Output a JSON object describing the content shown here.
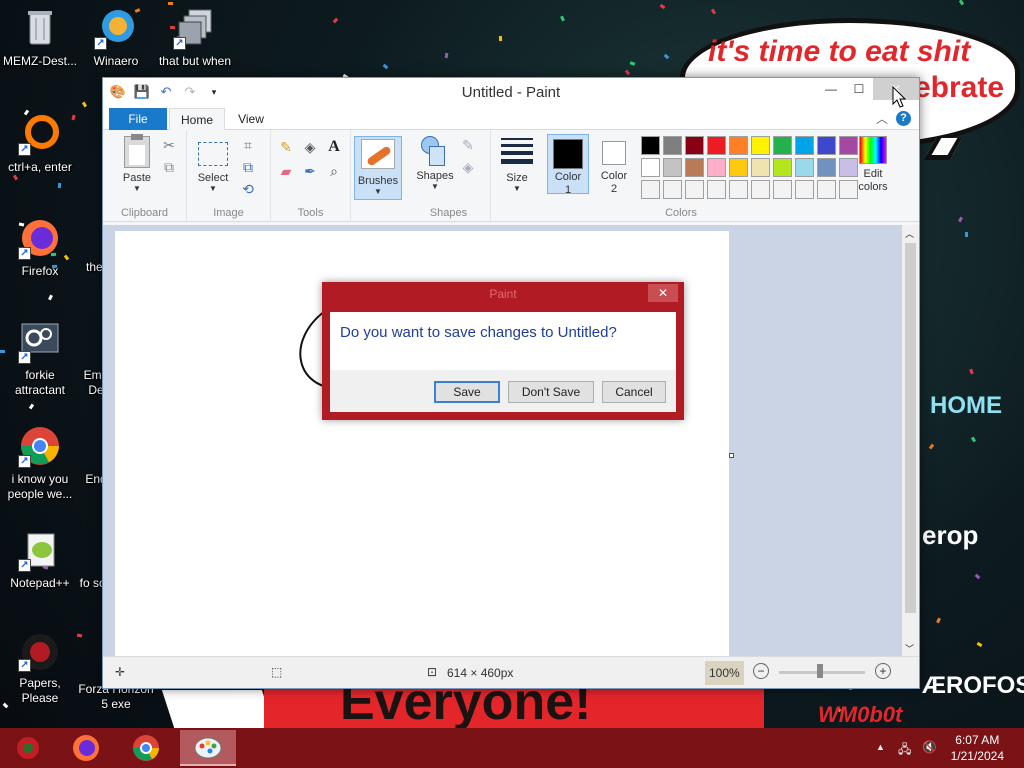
{
  "desktop": {
    "speech_line1": "it's time to eat shit",
    "speech_line2": "ebrate",
    "banner": "Everyone!",
    "bg_home": "HOME",
    "bg_erop": "erop",
    "bg_aero": "ÆROFOS",
    "bg_wmob": "WM0b0t",
    "icons": [
      {
        "label": "MEMZ-Dest..."
      },
      {
        "label": "Winaero"
      },
      {
        "label": "that but when"
      },
      {
        "label": "ctrl+a, enter"
      },
      {
        "label": "Firefox"
      },
      {
        "label": "the"
      },
      {
        "label": "forkie attractant"
      },
      {
        "label": "Emb De"
      },
      {
        "label": "i know you people we..."
      },
      {
        "label": "End"
      },
      {
        "label": "Notepad++"
      },
      {
        "label": "fo son"
      },
      {
        "label": "Papers, Please"
      },
      {
        "label": "Forza Horizon 5 exe"
      }
    ]
  },
  "paint": {
    "title": "Untitled - Paint",
    "tabs": {
      "file": "File",
      "home": "Home",
      "view": "View"
    },
    "groups": {
      "clipboard": {
        "label": "Clipboard",
        "paste": "Paste"
      },
      "image": {
        "label": "Image",
        "select": "Select"
      },
      "tools": {
        "label": "Tools"
      },
      "brushes": {
        "label": "Brushes"
      },
      "shapes": {
        "label": "Shapes",
        "shapes_btn": "Shapes"
      },
      "size": {
        "label": "Size"
      },
      "colors": {
        "label": "Colors",
        "color1": "Color 1",
        "color2": "Color 2",
        "edit": "Edit colors"
      }
    },
    "palette_row1": [
      "#000000",
      "#7f7f7f",
      "#880015",
      "#ed1c24",
      "#ff7f27",
      "#fff200",
      "#22b14c",
      "#00a2e8",
      "#3f48cc",
      "#a349a4"
    ],
    "palette_row2": [
      "#ffffff",
      "#c3c3c3",
      "#b97a57",
      "#ffaec9",
      "#ffc90e",
      "#efe4b0",
      "#b5e61d",
      "#99d9ea",
      "#7092be",
      "#c8bfe7"
    ],
    "status": {
      "dimensions": "614 × 460px",
      "zoom": "100%"
    }
  },
  "dialog": {
    "title": "Paint",
    "message": "Do you want to save changes to Untitled?",
    "save": "Save",
    "dont_save": "Don't Save",
    "cancel": "Cancel"
  },
  "taskbar": {
    "time": "6:07 AM",
    "date": "1/21/2024"
  }
}
